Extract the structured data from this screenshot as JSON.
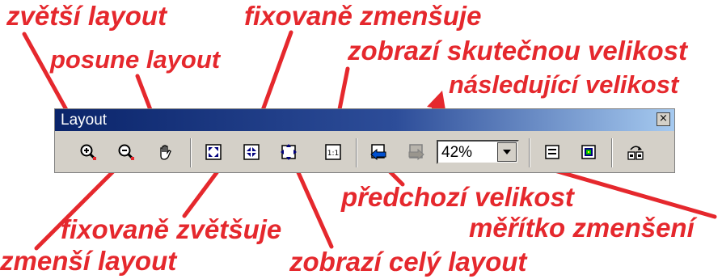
{
  "toolbar": {
    "title": "Layout",
    "close_symbol": "×",
    "zoom_value": "42%",
    "buttons": [
      {
        "icon": "zoom-in-icon"
      },
      {
        "icon": "zoom-out-icon"
      },
      {
        "icon": "pan-hand-icon"
      },
      {
        "icon": "fixed-zoom-in-icon"
      },
      {
        "icon": "fixed-zoom-out-icon"
      },
      {
        "icon": "fit-page-icon"
      },
      {
        "icon": "actual-size-icon"
      },
      {
        "icon": "previous-view-icon"
      },
      {
        "icon": "next-view-icon"
      },
      {
        "icon": "zoom-select-dropdown-icon"
      },
      {
        "icon": "page-icon"
      },
      {
        "icon": "page-colored-icon"
      },
      {
        "icon": "multi-page-refresh-icon"
      }
    ]
  },
  "annotations": {
    "zoom_in": "zvětší layout",
    "pan": "posune layout",
    "fixed_zoom_out": "fixovaně zmenšuje",
    "actual_size": "zobrazí skutečnou velikost",
    "next_size": "následující velikost",
    "previous_size": "předchozí velikost",
    "scale": "měřítko zmenšení",
    "fixed_zoom_in": "fixovaně zvětšuje",
    "zoom_out": "zmenší layout",
    "fit_layout": "zobrazí celý layout"
  },
  "colors": {
    "annotation": "#e5282d",
    "titlebar_start": "#0a246a",
    "titlebar_end": "#a6caf0",
    "toolbar_bg": "#d4d0c8"
  }
}
